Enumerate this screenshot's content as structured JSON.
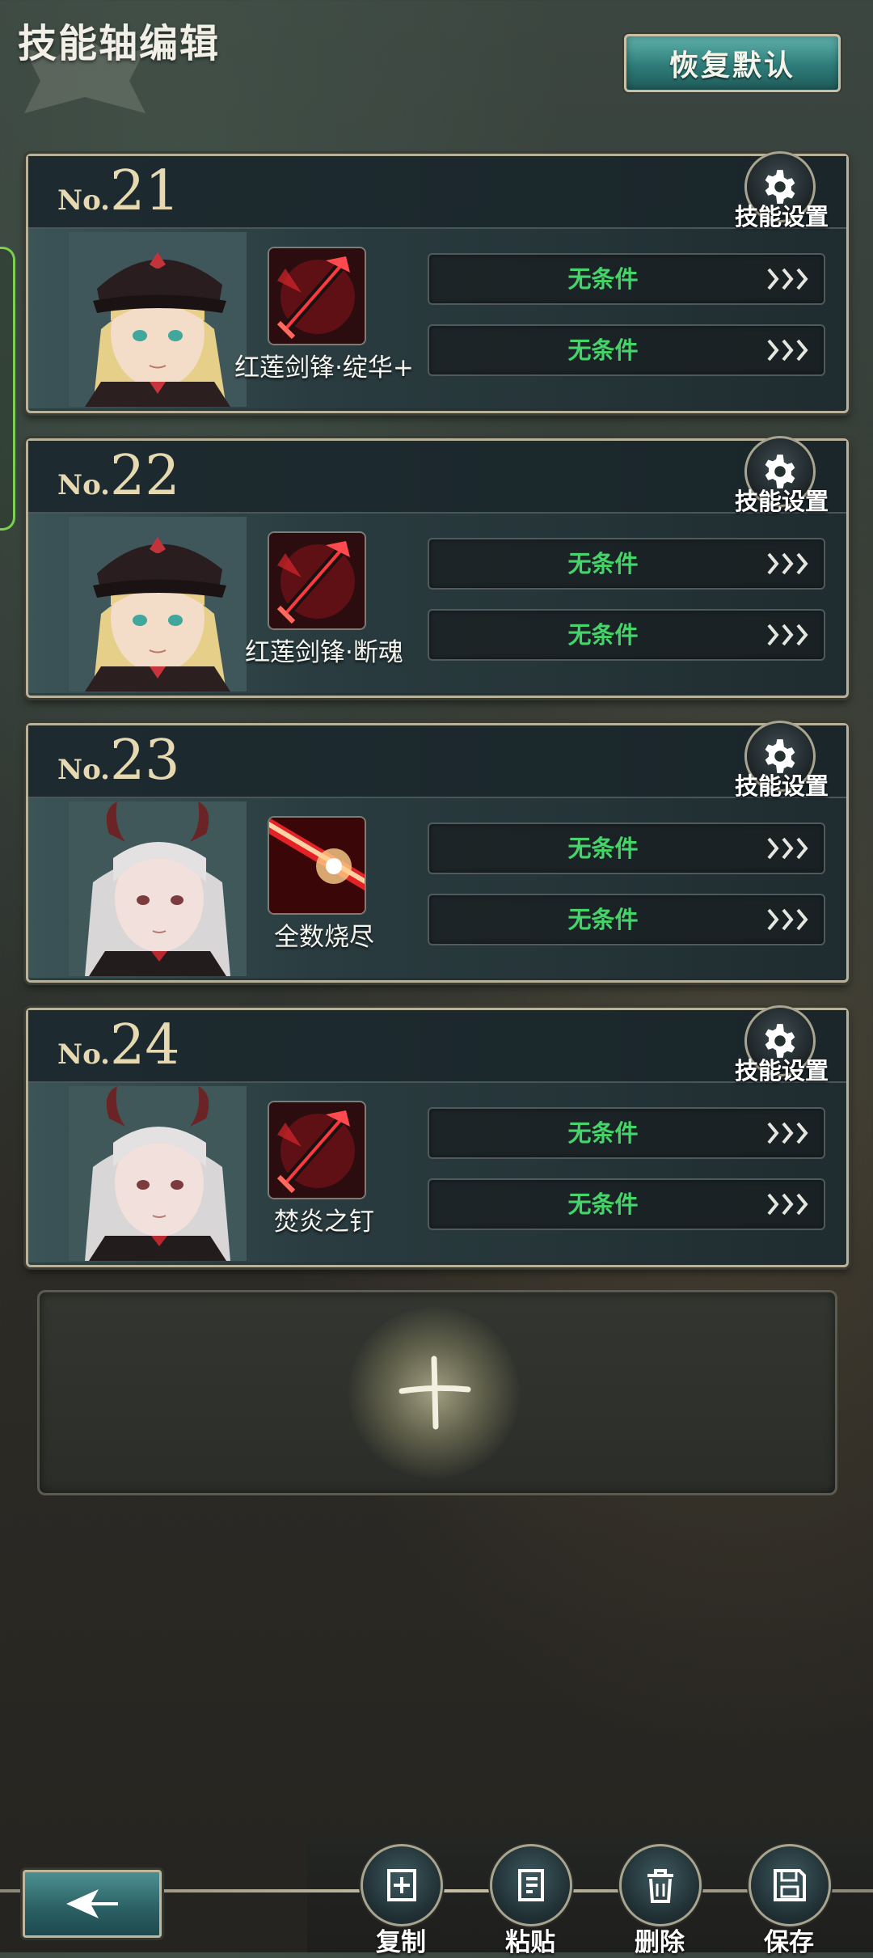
{
  "header": {
    "title": "技能轴编辑",
    "reset_label": "恢复默认"
  },
  "cards": [
    {
      "no_prefix": "No.",
      "no_value": "21",
      "skill_name": "红莲剑锋·绽华+",
      "gear_label": "技能设置",
      "condition1": "无条件",
      "condition2": "无条件",
      "character": "blonde-officer",
      "skill_icon": "red-sword"
    },
    {
      "no_prefix": "No.",
      "no_value": "22",
      "skill_name": "红莲剑锋·断魂",
      "gear_label": "技能设置",
      "condition1": "无条件",
      "condition2": "无条件",
      "character": "blonde-officer",
      "skill_icon": "red-sword"
    },
    {
      "no_prefix": "No.",
      "no_value": "23",
      "skill_name": "全数烧尽",
      "gear_label": "技能设置",
      "condition1": "无条件",
      "condition2": "无条件",
      "character": "silver-horned",
      "skill_icon": "red-beam"
    },
    {
      "no_prefix": "No.",
      "no_value": "24",
      "skill_name": "焚炎之钉",
      "gear_label": "技能设置",
      "condition1": "无条件",
      "condition2": "无条件",
      "character": "silver-horned",
      "skill_icon": "red-sword"
    }
  ],
  "toolbar": {
    "copy_label": "复制",
    "paste_label": "粘贴",
    "delete_label": "删除",
    "save_label": "保存"
  },
  "colors": {
    "condition_text": "#46d36a",
    "accent_teal": "#2e7c79",
    "frame_gold": "#b9b29a"
  }
}
